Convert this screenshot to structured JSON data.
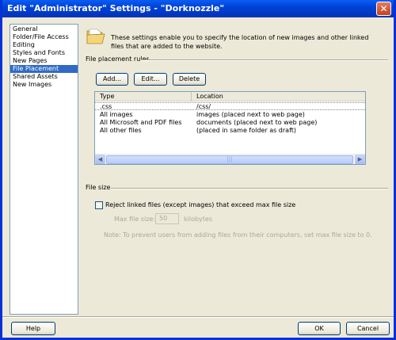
{
  "window": {
    "title": "Edit \"Administrator\" Settings - \"Dorknozzle\"",
    "close_glyph": "✕"
  },
  "sidebar": {
    "items": [
      {
        "label": "General",
        "selected": false
      },
      {
        "label": "Folder/File Access",
        "selected": false
      },
      {
        "label": "Editing",
        "selected": false
      },
      {
        "label": "Styles and Fonts",
        "selected": false
      },
      {
        "label": "New Pages",
        "selected": false
      },
      {
        "label": "File Placement",
        "selected": true
      },
      {
        "label": "Shared Assets",
        "selected": false
      },
      {
        "label": "New Images",
        "selected": false
      }
    ]
  },
  "main": {
    "intro": "These settings enable you to specify the location of new images and other linked files that are added to the website.",
    "placement_section_label": "File placement rules",
    "buttons": {
      "add": "Add...",
      "edit": "Edit...",
      "delete": "Delete"
    },
    "table": {
      "columns": [
        "Type",
        "Location"
      ],
      "rows": [
        {
          "type": ".css",
          "location": "/css/"
        },
        {
          "type": "All images",
          "location": "images (placed next to web page)"
        },
        {
          "type": "All Microsoft and PDF files",
          "location": "documents (placed next to web page)"
        },
        {
          "type": "All other files",
          "location": "(placed in same folder as draft)"
        }
      ],
      "scroll_left_glyph": "◀",
      "scroll_right_glyph": "▶",
      "thumb_grip": "|||"
    },
    "file_size_section_label": "File size",
    "reject_checkbox_label": "Reject linked files (except images) that exceed max file size",
    "reject_checked": false,
    "max_file_size_label": "Max file size:",
    "max_file_size_value": "50",
    "max_file_size_unit": "kilobytes",
    "note": "Note: To prevent users from adding files from their computers, set max file size to 0."
  },
  "footer": {
    "help": "Help",
    "ok": "OK",
    "cancel": "Cancel"
  },
  "icons": {
    "folder": "folder-icon"
  },
  "colors": {
    "selection": "#316ac5",
    "titlebar": "#0042d6"
  }
}
